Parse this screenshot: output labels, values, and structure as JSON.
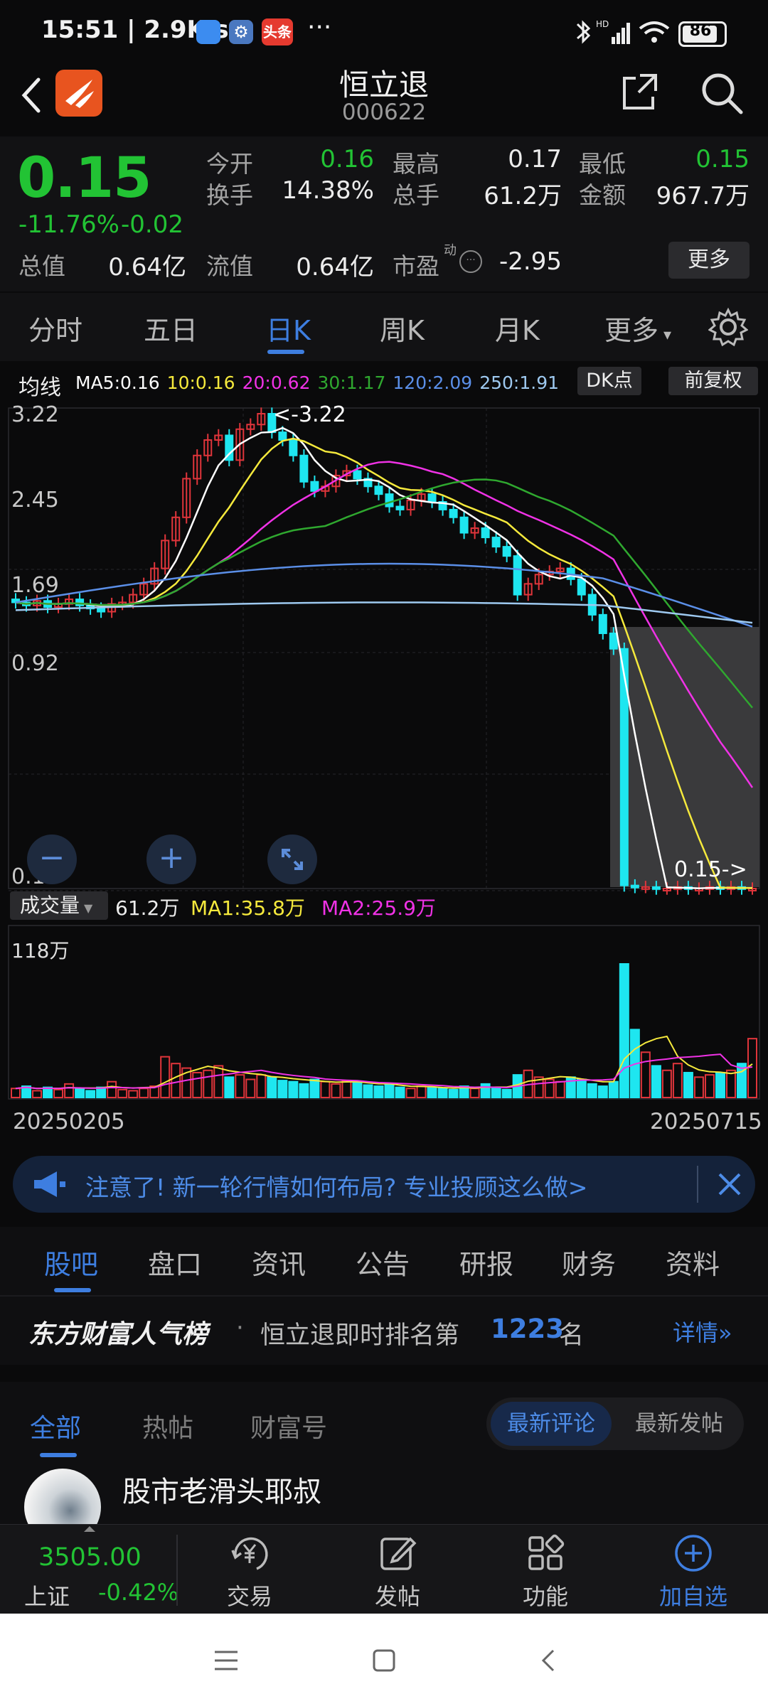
{
  "status_bar": {
    "time_speed": "15:51 | 2.9K/s",
    "app_badge": "头条",
    "more": "···",
    "battery": "86"
  },
  "header": {
    "name": "恒立退",
    "code": "000622"
  },
  "quote": {
    "price": "0.15",
    "change_pct": "-11.76%",
    "change": "-0.02",
    "rows": [
      [
        {
          "label": "今开",
          "value": "0.16",
          "color": "green"
        },
        {
          "label": "最高",
          "value": "0.17",
          "color": "white"
        },
        {
          "label": "最低",
          "value": "0.15",
          "color": "green"
        }
      ],
      [
        {
          "label": "换手",
          "value": "14.38%",
          "color": "white"
        },
        {
          "label": "总手",
          "value": "61.2万",
          "color": "white"
        },
        {
          "label": "金额",
          "value": "967.7万",
          "color": "white"
        }
      ]
    ],
    "total_value_label": "总值",
    "total_value": "0.64亿",
    "float_value_label": "流值",
    "float_value": "0.64亿",
    "pe_label": "市盈",
    "pe_superscript": "动",
    "pe_value": "-2.95",
    "more_button": "更多"
  },
  "kline_tabs": [
    {
      "label": "分时",
      "active": false
    },
    {
      "label": "五日",
      "active": false
    },
    {
      "label": "日K",
      "active": true
    },
    {
      "label": "周K",
      "active": false
    },
    {
      "label": "月K",
      "active": false
    },
    {
      "label": "更多",
      "active": false
    }
  ],
  "ma_legend": {
    "title": "均线",
    "items": [
      {
        "text": "MA5:0.16",
        "color": "#ffffff"
      },
      {
        "text": "10:0.16",
        "color": "#f5e93c"
      },
      {
        "text": "20:0.62",
        "color": "#f032e6"
      },
      {
        "text": "30:1.17",
        "color": "#2fa82f"
      },
      {
        "text": "120:2.09",
        "color": "#5b8fe8"
      },
      {
        "text": "250:1.91",
        "color": "#9ec9f0"
      }
    ],
    "dk_button": "DK点",
    "adjust_button": "前复权"
  },
  "chart_data": {
    "type": "candlestick",
    "y_ticks": [
      "3.22",
      "2.45",
      "1.69",
      "0.92",
      "0.15"
    ],
    "ylim": [
      0.15,
      3.22
    ],
    "max_label": "<-3.22",
    "last_label": "0.15->",
    "x_start": "20250205",
    "x_end": "20250715",
    "volume": {
      "indicator": "成交量",
      "current": "61.2万",
      "ma1": "MA1:35.8万",
      "ma2": "MA2:25.9万",
      "max_label": "118万"
    }
  },
  "colors": {
    "up": "#e0353b",
    "down": "#1ee6f0",
    "ma5": "#ffffff",
    "ma10": "#f5e93c",
    "ma20": "#f032e6",
    "ma30": "#2fa82f",
    "ma120": "#5b8fe8",
    "ma250": "#9ec9f0",
    "accent": "#3e7ee0"
  },
  "banner": {
    "text": "注意了! 新一轮行情如何布局? 专业投顾这么做>"
  },
  "sub_tabs": [
    "股吧",
    "盘口",
    "资讯",
    "公告",
    "研报",
    "财务",
    "资料"
  ],
  "rank": {
    "brand": "东方财富人气榜",
    "text_pre": "恒立退即时排名第",
    "rank": "1223",
    "text_post": "名",
    "detail": "详情"
  },
  "filters": {
    "tabs": [
      "全部",
      "热帖",
      "财富号"
    ],
    "sort_options": [
      "最新评论",
      "最新发帖"
    ]
  },
  "post": {
    "author": "股市老滑头耶叔"
  },
  "bottom_nav": {
    "index_value": "3505.00",
    "index_name": "上证",
    "index_change": "-0.42%",
    "items": [
      "交易",
      "发帖",
      "功能",
      "加自选"
    ]
  }
}
